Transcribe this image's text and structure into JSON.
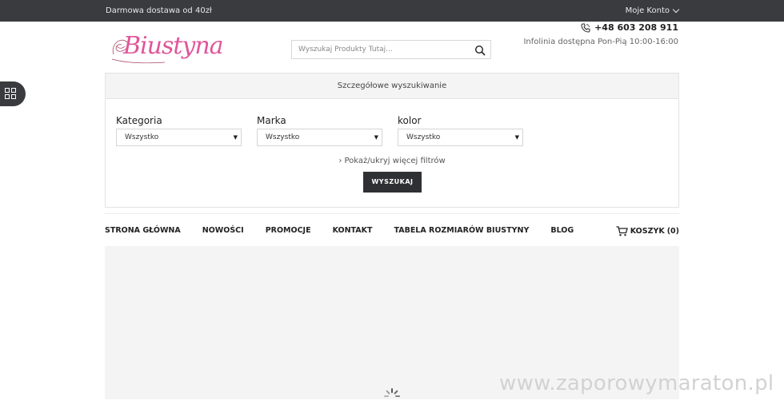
{
  "topbar": {
    "shipping": "Darmowa dostawa od 40zł",
    "account": "Moje Konto"
  },
  "header": {
    "logo": "Biustyna",
    "search_placeholder": "Wyszukaj Produkty Tutaj...",
    "phone": "+48 603 208 911",
    "hours": "Infolinia dostępna Pon-Pią 10:00-16:00"
  },
  "advanced": {
    "title": "Szczegółowe wyszukiwanie",
    "filters": [
      {
        "label": "Kategoria",
        "value": "Wszystko"
      },
      {
        "label": "Marka",
        "value": "Wszystko"
      },
      {
        "label": "kolor",
        "value": "Wszystko"
      }
    ],
    "more": "Pokaż/ukryj więcej filtrów",
    "submit": "WYSZUKAJ"
  },
  "nav": [
    "STRONA GŁÓWNA",
    "NOWOŚCI",
    "PROMOCJE",
    "KONTAKT",
    "TABELA ROZMIARÓW BIUSTYNY",
    "BLOG"
  ],
  "cart": {
    "label": "KOSZYK",
    "count": "(0)"
  },
  "watermark": "www.zaporowymaraton.pl",
  "colors": {
    "topbar": "#3a3b3f",
    "brand": "#e0559a",
    "button": "#2f3033"
  },
  "icons": [
    "chevron-down-icon",
    "search-icon",
    "phone-icon",
    "grid-icon",
    "cart-icon",
    "spinner-icon"
  ]
}
